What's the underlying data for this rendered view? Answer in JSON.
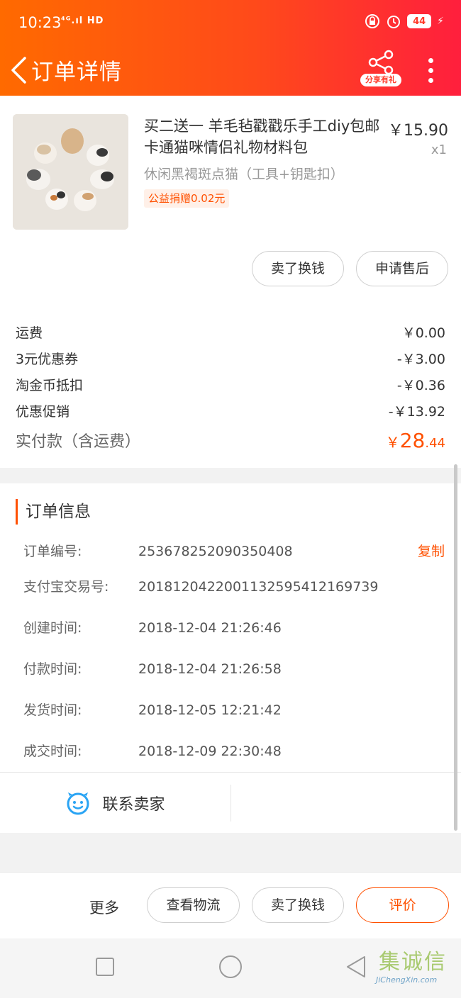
{
  "status_bar": {
    "time": "10:23",
    "signal": "⁴ᴳ.ıl HD",
    "battery": "44"
  },
  "nav": {
    "title": "订单详情",
    "share_label": "分享有礼"
  },
  "product": {
    "title": "买二送一 羊毛毡戳戳乐手工diy包邮卡通猫咪情侣礼物材料包",
    "price": "￥15.90",
    "quantity": "x1",
    "sku": "休闲黑褐斑点猫（工具+钥匙扣）",
    "charity": "公益捐赠0.02元",
    "buttons": {
      "sell": "卖了换钱",
      "after_sale": "申请售后"
    }
  },
  "fees": [
    {
      "label": "运费",
      "amount": "￥0.00"
    },
    {
      "label": "3元优惠券",
      "amount": "-￥3.00"
    },
    {
      "label": "淘金币抵扣",
      "amount": "-￥0.36"
    },
    {
      "label": "优惠促销",
      "amount": "-￥13.92"
    }
  ],
  "total": {
    "label": "实付款（含运费）",
    "currency": "￥",
    "integer": "28",
    "decimal": ".44"
  },
  "order_info": {
    "title": "订单信息",
    "rows": [
      {
        "label": "订单编号:",
        "value": "253678252090350408"
      },
      {
        "label": "支付宝交易号:",
        "value": "2018120422001132595412169739"
      },
      {
        "label": "创建时间:",
        "value": "2018-12-04 21:26:46"
      },
      {
        "label": "付款时间:",
        "value": "2018-12-04 21:26:58"
      },
      {
        "label": "发货时间:",
        "value": "2018-12-05 12:21:42"
      },
      {
        "label": "成交时间:",
        "value": "2018-12-09 22:30:48"
      }
    ],
    "copy_label": "复制",
    "contact_label": "联系卖家"
  },
  "action_bar": {
    "more": "更多",
    "logistics": "查看物流",
    "sell": "卖了换钱",
    "review": "评价"
  },
  "watermark": {
    "main": "集诚信",
    "sub": "JiChengXin.com"
  },
  "colors": {
    "accent": "#ff5000",
    "header_start": "#ff6a00",
    "header_end": "#ff1f3d"
  }
}
